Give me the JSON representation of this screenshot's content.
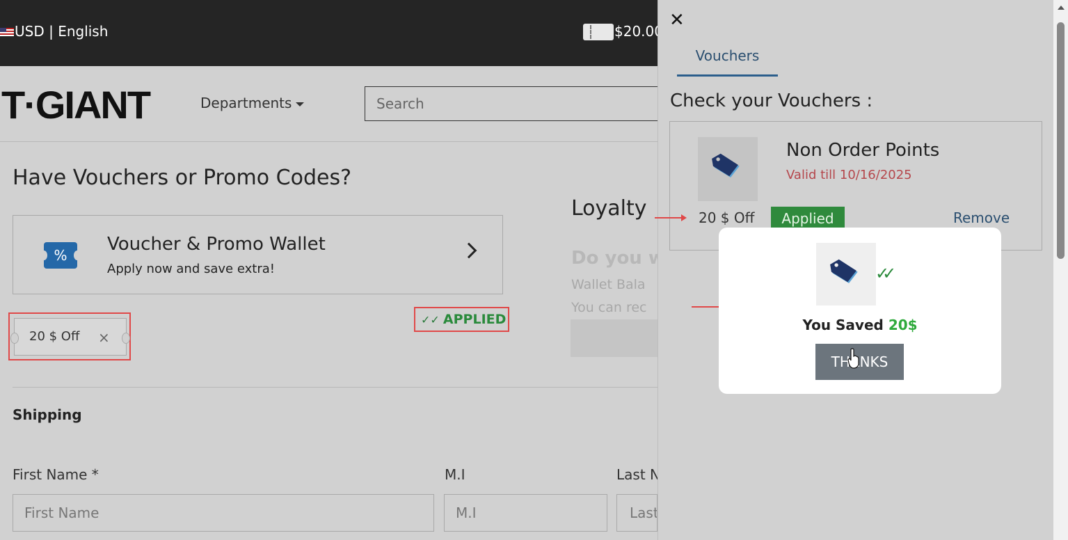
{
  "topbar": {
    "locale": "USD | English",
    "balance": "$20.00"
  },
  "header": {
    "logo": "T·GIANT",
    "departments": "Departments",
    "search_placeholder": "Search"
  },
  "vouchers_section": {
    "title": "Have Vouchers or Promo Codes?",
    "wallet_title": "Voucher & Promo Wallet",
    "wallet_subtitle": "Apply now and save extra!",
    "wallet_icon_glyph": "%",
    "chip_label": "20 $ Off",
    "chip_remove": "×",
    "applied_label": "APPLIED"
  },
  "loyalty": {
    "title": "Loyalty",
    "question": "Do you w",
    "line1": "Wallet Bala",
    "line2": "You can rec"
  },
  "shipping": {
    "title": "Shipping",
    "first_name_label": "First Name *",
    "first_name_placeholder": "First Name",
    "mi_label": "M.I",
    "mi_placeholder": "M.I",
    "last_name_label": "Last N",
    "last_name_placeholder": "Last"
  },
  "panel": {
    "close": "✕",
    "tab": "Vouchers",
    "heading": "Check your Vouchers :",
    "voucher": {
      "name": "Non Order Points",
      "valid": "Valid till 10/16/2025",
      "amount": "20 $ Off",
      "badge": "Applied",
      "remove": "Remove"
    }
  },
  "popup": {
    "saved_text": "You Saved",
    "saved_amount": "20$",
    "button": "THANKS",
    "check": "✓✓"
  },
  "colors": {
    "accent_blue": "#2b5e8c",
    "success_green": "#2f8a3c",
    "highlight_red": "#e04848"
  }
}
